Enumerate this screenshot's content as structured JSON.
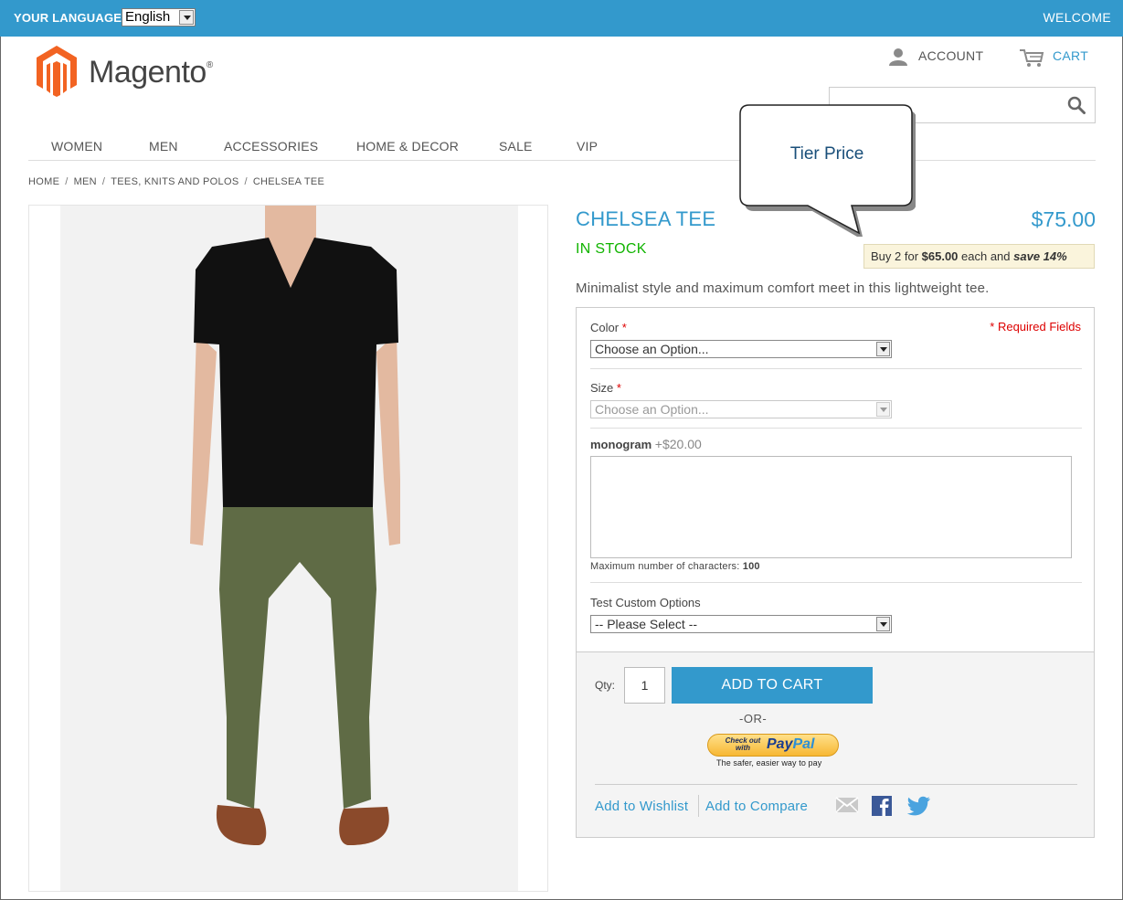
{
  "topbar": {
    "language_label": "YOUR LANGUAGE:",
    "language_value": "English",
    "welcome": "WELCOME"
  },
  "header": {
    "logo_text": "Magento",
    "logo_reg": "®",
    "account": "ACCOUNT",
    "cart": "CART",
    "search_placeholder": ""
  },
  "nav": [
    "WOMEN",
    "MEN",
    "ACCESSORIES",
    "HOME & DECOR",
    "SALE",
    "VIP"
  ],
  "breadcrumb": [
    "HOME",
    "MEN",
    "TEES, KNITS AND POLOS",
    "CHELSEA TEE"
  ],
  "breadcrumb_sep": "/",
  "callout": "Tier Price",
  "product": {
    "name": "CHELSEA TEE",
    "price": "$75.00",
    "stock": "IN STOCK",
    "tier": {
      "prefix": "Buy 2 for ",
      "price": "$65.00",
      "middle": " each and ",
      "save": "save 14%"
    },
    "description": "Minimalist style and maximum comfort meet in this lightweight tee."
  },
  "options": {
    "required_note": "* Required Fields",
    "color_label": "Color",
    "color_value": "Choose an Option...",
    "size_label": "Size",
    "size_value": "Choose an Option...",
    "required_mark": "*",
    "monogram_label": "monogram",
    "monogram_extra": "+$20.00",
    "max_chars_label": "Maximum number of characters:",
    "max_chars_value": "100",
    "custom_label": "Test Custom Options",
    "custom_value": "-- Please Select --"
  },
  "cart": {
    "qty_label": "Qty:",
    "qty_value": "1",
    "add_button": "ADD TO CART",
    "or": "-OR-",
    "paypal_small": "Check out with",
    "paypal_pay": "Pay",
    "paypal_pal": "Pal",
    "paypal_tagline": "The safer, easier way to pay",
    "wishlist": "Add to Wishlist",
    "compare": "Add to Compare"
  },
  "colors": {
    "accent": "#3399cc",
    "stock_green": "#11b400",
    "required_red": "#dd0000",
    "logo_orange": "#f26322"
  }
}
